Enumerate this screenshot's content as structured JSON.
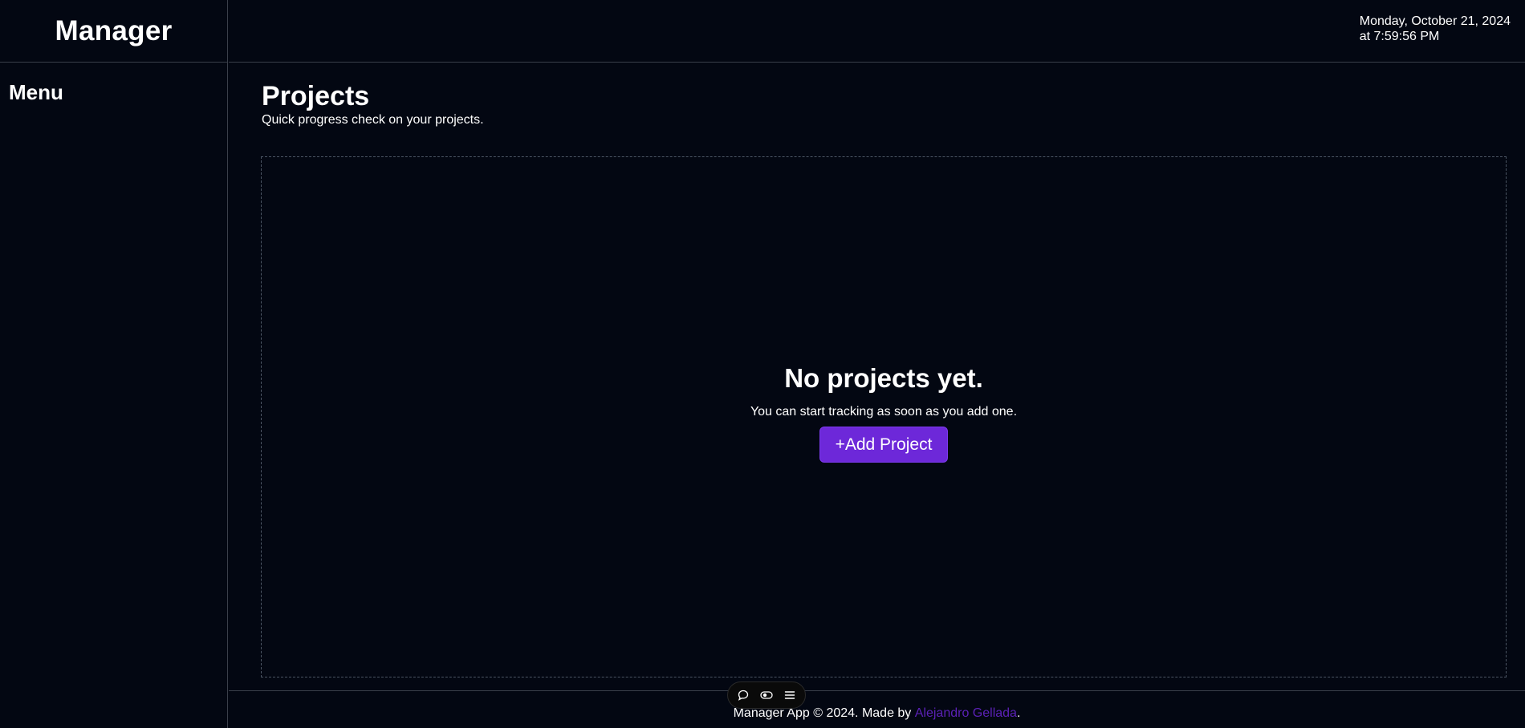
{
  "brand": {
    "title": "Manager"
  },
  "header": {
    "date_line": "Monday, October 21, 2024",
    "time_line": "at 7:59:56 PM"
  },
  "sidebar": {
    "menu_title": "Menu"
  },
  "main": {
    "title": "Projects",
    "subtitle": "Quick progress check on your projects.",
    "empty_state": {
      "title": "No projects yet.",
      "text": "You can start tracking as soon as you add one.",
      "button_label": "+Add Project"
    }
  },
  "footer": {
    "prefix": "Manager App © 2024. Made by ",
    "author": "Alejandro Gellada",
    "suffix": "."
  },
  "floating_toolbar": {
    "icons": [
      "chat-icon",
      "toggle-icon",
      "menu-icon"
    ]
  },
  "colors": {
    "background": "#030712",
    "border": "#3a3f4a",
    "accent": "#6d28d9",
    "link": "#5b21b6"
  }
}
